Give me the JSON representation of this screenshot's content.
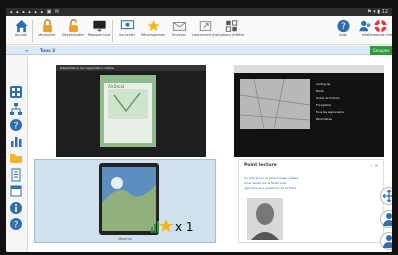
{
  "statusbar": {
    "left_icons": "▴ ▴ ▴ ▴ ▴ ▴ ▣ ✉",
    "right_icons": "⚑ ▾ ▮ 12"
  },
  "toolbar": {
    "items": [
      {
        "label": "Accueil",
        "icon": "home-icon"
      },
      {
        "label": "Verrouiller",
        "icon": "lock-icon"
      },
      {
        "label": "Déverrouiller",
        "icon": "unlock-icon"
      },
      {
        "label": "Masquer tout",
        "icon": "monitor-icon"
      },
      {
        "label": "Surveiller",
        "icon": "monitor-watch-icon"
      },
      {
        "label": "Récompenses",
        "icon": "star-icon"
      },
      {
        "label": "Envoyer",
        "icon": "envelope-icon"
      },
      {
        "label": "Lancement d'appli",
        "icon": "launch-icon"
      },
      {
        "label": "Options d'élèves",
        "icon": "grid-icon"
      }
    ],
    "right_items": [
      {
        "label": "Aide",
        "icon": "help-icon"
      },
      {
        "label": "Info",
        "icon": "users-icon"
      },
      {
        "label": "Demande d'aide",
        "icon": "lifebuoy-icon"
      }
    ]
  },
  "session": {
    "left": "≡",
    "title": "Tous 3",
    "button": "Groupes"
  },
  "thumbs": {
    "t1": {
      "bar_text": "Présentation de l'application mobile",
      "app_name": "AirDroid"
    },
    "t2": {
      "menu": [
        "Configurer",
        "Mode",
        "Outils de fichiers",
        "Enregistrer",
        "Tous les apprenants",
        "Paramètres"
      ]
    },
    "t3": {
      "label": "Maxime",
      "score": "x 1"
    },
    "t4": {
      "title": "Point lecture",
      "lines": [
        "Un article sur le personnage célèbre",
        "Vous devez lire le texte puis",
        "répondre aux questions de la fiche"
      ]
    }
  }
}
